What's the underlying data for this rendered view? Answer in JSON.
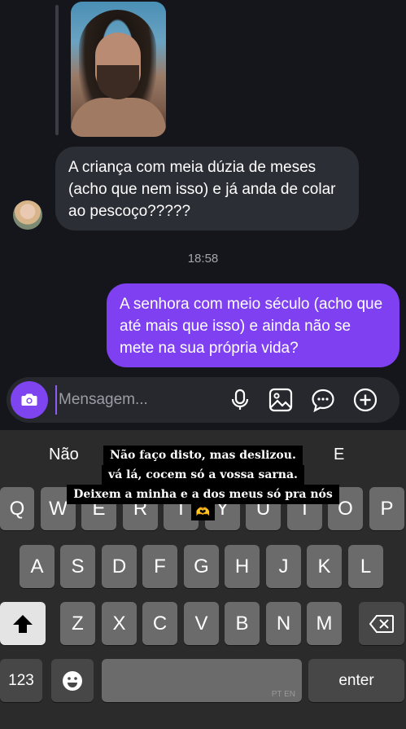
{
  "chat": {
    "incoming_message": "A criança com meia dúzia de meses (acho que nem isso) e já anda de colar ao pescoço?????",
    "timestamp": "18:58",
    "outgoing_message": "A senhora com meio século (acho que até mais que isso) e ainda não se mete na sua própria vida?"
  },
  "composer": {
    "placeholder": "Mensagem...",
    "icons": [
      "camera-icon",
      "microphone-icon",
      "gallery-icon",
      "sticker-icon",
      "plus-icon"
    ]
  },
  "keyboard": {
    "suggestions": [
      "Não",
      "",
      "E"
    ],
    "row1": [
      "Q",
      "W",
      "E",
      "R",
      "T",
      "Y",
      "U",
      "I",
      "O",
      "P"
    ],
    "row2": [
      "A",
      "S",
      "D",
      "F",
      "G",
      "H",
      "J",
      "K",
      "L"
    ],
    "row3": [
      "Z",
      "X",
      "C",
      "V",
      "B",
      "N",
      "M"
    ],
    "numbers_label": "123",
    "enter_label": "enter",
    "language_label": "PT EN"
  },
  "caption": {
    "line1": "Não faço disto, mas deslizou.",
    "line2": "vá lá, cocem só a vossa sarna.",
    "line3": "Deixem a minha e a dos meus só pra nós",
    "emoji": "🫶"
  },
  "colors": {
    "background": "#14161b",
    "incoming_bubble": "#2c2e35",
    "outgoing_bubble": "#7f40f2",
    "keyboard": "#2b2b2b",
    "key": "#6b6b6b"
  }
}
